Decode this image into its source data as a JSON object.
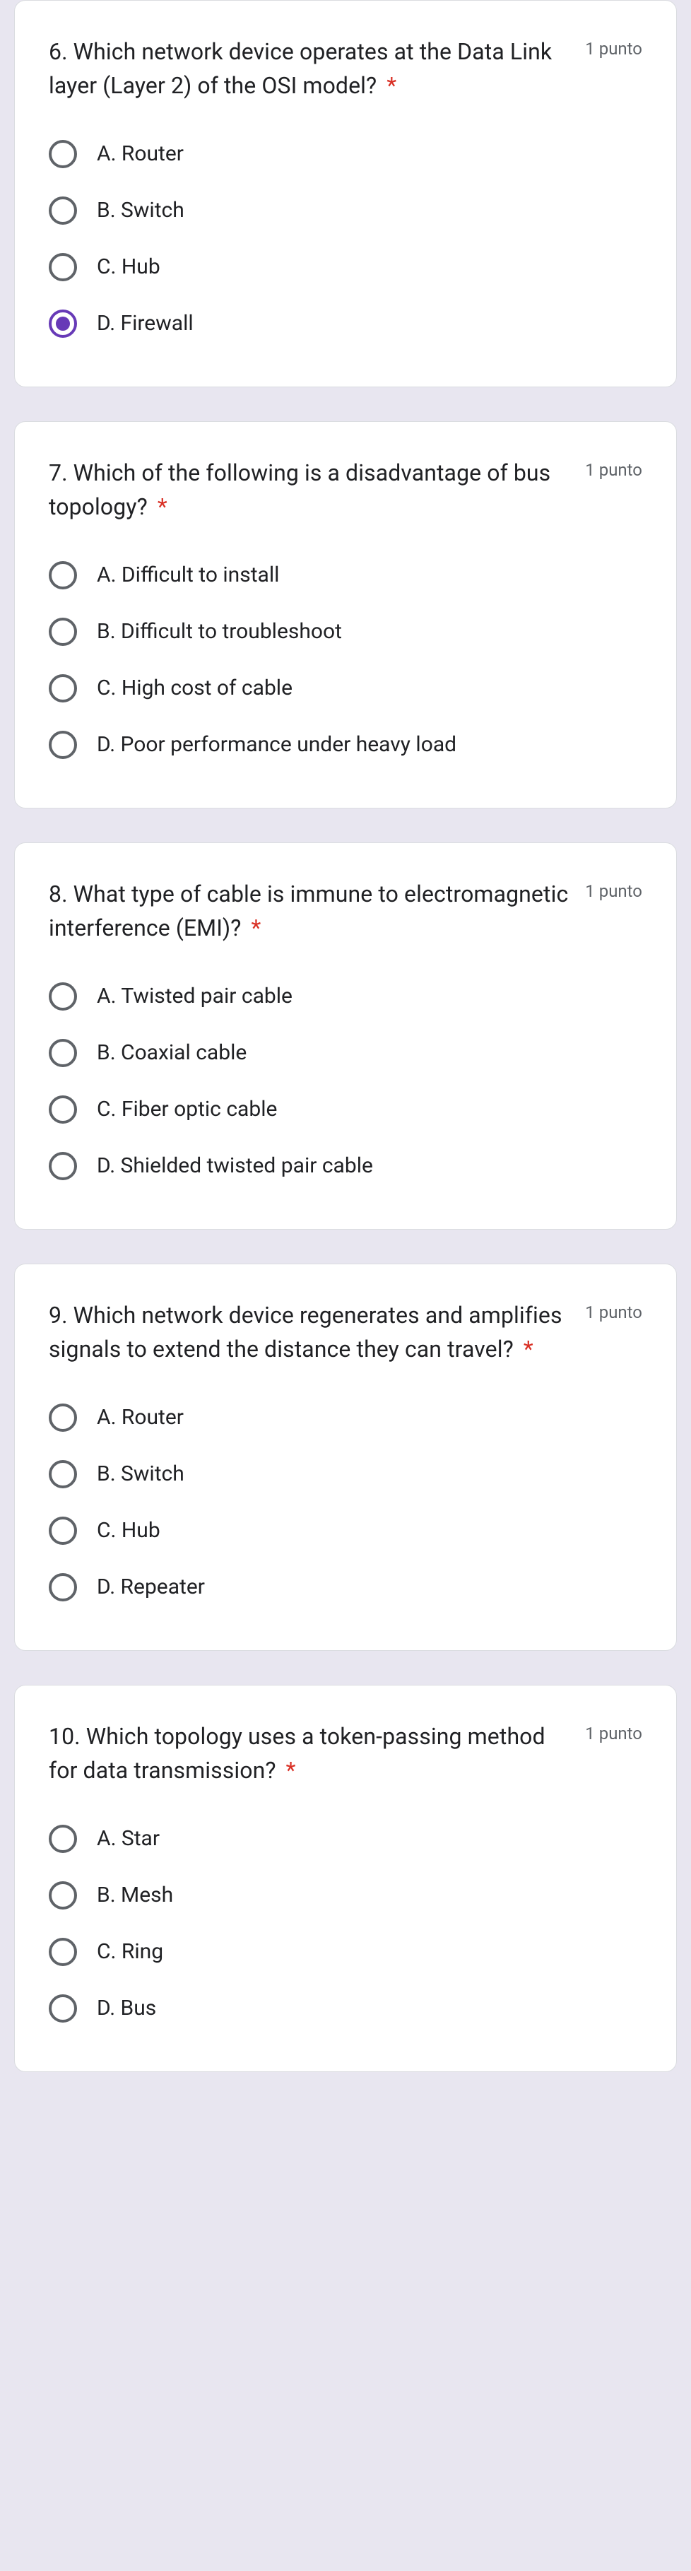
{
  "points_label": "1 punto",
  "questions": [
    {
      "text": "6. Which network device operates at the Data Link layer (Layer 2) of the OSI model?",
      "options": [
        "A. Router",
        "B. Switch",
        "C. Hub",
        "D. Firewall"
      ],
      "selected": 3
    },
    {
      "text": "7. Which of the following is a disadvantage of bus topology?",
      "options": [
        "A. Difficult to install",
        "B. Difficult to troubleshoot",
        "C. High cost of cable",
        "D. Poor performance under heavy load"
      ],
      "selected": -1
    },
    {
      "text": "8. What type of cable is immune to electromagnetic interference (EMI)?",
      "options": [
        "A. Twisted pair cable",
        "B. Coaxial cable",
        "C. Fiber optic cable",
        "D. Shielded twisted pair cable"
      ],
      "selected": -1
    },
    {
      "text": "9. Which network device regenerates and amplifies signals to extend the distance they can travel?",
      "options": [
        "A. Router",
        "B. Switch",
        "C. Hub",
        "D. Repeater"
      ],
      "selected": -1
    },
    {
      "text": "10. Which topology uses a token-passing method for data transmission?",
      "options": [
        "A. Star",
        "B. Mesh",
        "C. Ring",
        "D. Bus"
      ],
      "selected": -1
    }
  ]
}
